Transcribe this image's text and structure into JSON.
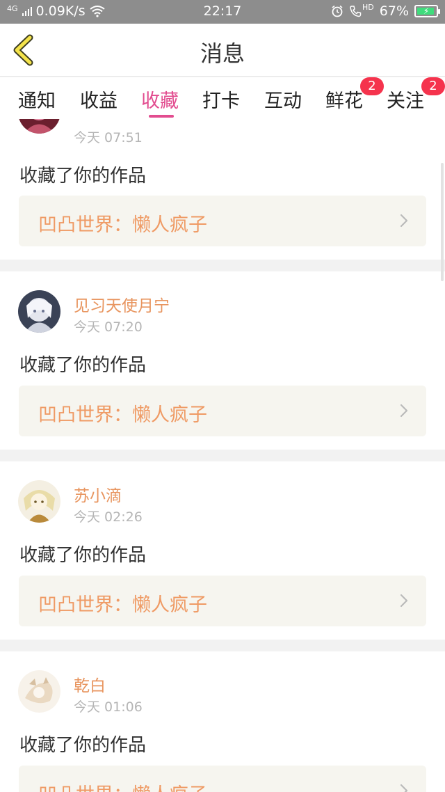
{
  "status_bar": {
    "network": "4G",
    "speed": "0.09K/s",
    "time": "22:17",
    "hd": "HD",
    "battery": "67%",
    "battery_level": 0.67
  },
  "header": {
    "title": "消息"
  },
  "tabs": [
    {
      "label": "通知",
      "active": false,
      "badge": null
    },
    {
      "label": "收益",
      "active": false,
      "badge": null
    },
    {
      "label": "收藏",
      "active": true,
      "badge": null
    },
    {
      "label": "打卡",
      "active": false,
      "badge": null
    },
    {
      "label": "互动",
      "active": false,
      "badge": null
    },
    {
      "label": "鲜花",
      "active": false,
      "badge": "2"
    },
    {
      "label": "关注",
      "active": false,
      "badge": "2"
    }
  ],
  "messages": [
    {
      "user": "",
      "time": "今天 07:51",
      "action": "收藏了你的作品",
      "work": "凹凸世界：懒人疯子"
    },
    {
      "user": "见习天使月宁",
      "time": "今天 07:20",
      "action": "收藏了你的作品",
      "work": "凹凸世界：懒人疯子"
    },
    {
      "user": "苏小滴",
      "time": "今天 02:26",
      "action": "收藏了你的作品",
      "work": "凹凸世界：懒人疯子"
    },
    {
      "user": "乾白",
      "time": "今天 01:06",
      "action": "收藏了你的作品",
      "work": "凹凸世界：懒人疯子"
    }
  ],
  "colors": {
    "accent": "#e24c8f",
    "work_text": "#ef9a64",
    "username": "#e8955f",
    "badge": "#f5334d"
  }
}
